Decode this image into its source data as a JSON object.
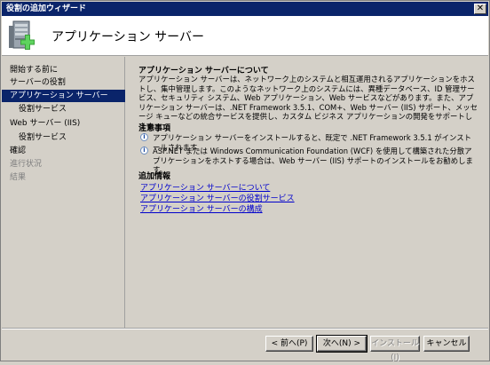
{
  "window": {
    "title": "役割の追加ウィザード",
    "close_glyph": "✕"
  },
  "header": {
    "title": "アプリケーション サーバー",
    "icon": "server-add-icon"
  },
  "sidebar": {
    "items": [
      {
        "label": "開始する前に",
        "state": "normal",
        "level": 0
      },
      {
        "label": "サーバーの役割",
        "state": "normal",
        "level": 0
      },
      {
        "label": "アプリケーション サーバー",
        "state": "selected",
        "level": 0
      },
      {
        "label": "役割サービス",
        "state": "normal",
        "level": 1
      },
      {
        "label": "Web サーバー (IIS)",
        "state": "normal",
        "level": 0
      },
      {
        "label": "役割サービス",
        "state": "normal",
        "level": 1
      },
      {
        "label": "確認",
        "state": "normal",
        "level": 0
      },
      {
        "label": "進行状況",
        "state": "disabled",
        "level": 0
      },
      {
        "label": "結果",
        "state": "disabled",
        "level": 0
      }
    ]
  },
  "content": {
    "about_title": "アプリケーション サーバーについて",
    "about_text": "アプリケーション サーバーは、ネットワーク上のシステムと相互運用されるアプリケーションをホストし、集中管理します。このようなネットワーク上のシステムには、異種データベース、ID 管理サービス、セキュリティ システム、Web アプリケーション、Web サービスなどがあります。また、アプリケーション サーバーは、.NET Framework 3.5.1、COM+、Web サーバー (IIS) サポート、メッセージ キューなどの統合サービスを提供し、カスタム ビジネス アプリケーションの開発をサポートします。",
    "notes_title": "注意事項",
    "notes": [
      "アプリケーション サーバーをインストールすると、既定で .NET Framework 3.5.1 がインストールされます。",
      "ASP.NET または Windows Communication Foundation (WCF) を使用して構築された分散アプリケーションをホストする場合は、Web サーバー (IIS) サポートのインストールをお勧めします。"
    ],
    "more_info_title": "追加情報",
    "links": [
      "アプリケーション サーバーについて",
      "アプリケーション サーバーの役割サービス",
      "アプリケーション サーバーの構成"
    ]
  },
  "buttons": {
    "back": "< 前へ(P)",
    "next": "次へ(N) >",
    "install": "インストール(I)",
    "cancel": "キャンセル"
  }
}
